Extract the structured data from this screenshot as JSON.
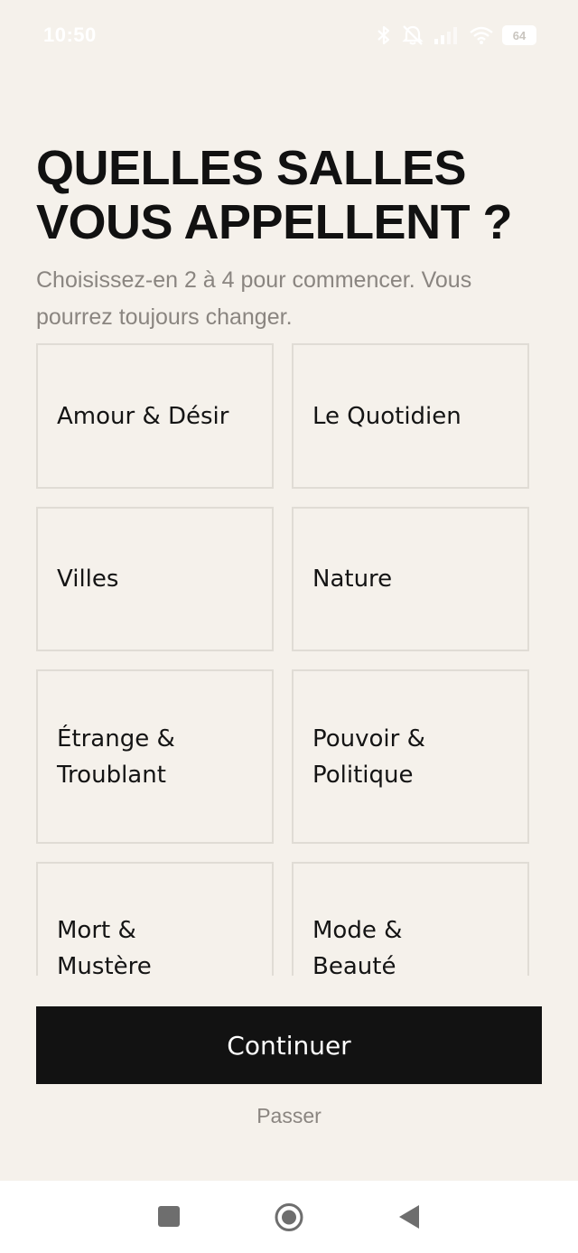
{
  "status_bar": {
    "time": "10:50",
    "battery": "64",
    "icons": [
      "bluetooth-icon",
      "bell-muted-icon",
      "signal-icon",
      "wifi-icon",
      "battery-icon"
    ]
  },
  "header": {
    "title_line1": "QUELLES SALLES",
    "title_line2": "VOUS APPELLENT ?",
    "subtitle": "Choisissez-en 2 à 4 pour commencer. Vous pourrez toujours changer."
  },
  "rooms": [
    {
      "label": "Amour & Désir"
    },
    {
      "label": "Le Quotidien"
    },
    {
      "label": "Villes"
    },
    {
      "label": "Nature"
    },
    {
      "label": "Étrange & Troublant"
    },
    {
      "label": "Pouvoir & Politique"
    },
    {
      "label": "Mort & Mustère"
    },
    {
      "label": "Mode & Beauté"
    }
  ],
  "actions": {
    "continue_label": "Continuer",
    "skip_label": "Passer"
  },
  "nav_bar": {
    "icons": [
      "square-recents-icon",
      "circle-home-icon",
      "triangle-back-icon"
    ]
  },
  "colors": {
    "background": "#f5f1eb",
    "primary": "#121212",
    "muted_text": "#8a8580",
    "card_border": "#e0dcd5"
  }
}
